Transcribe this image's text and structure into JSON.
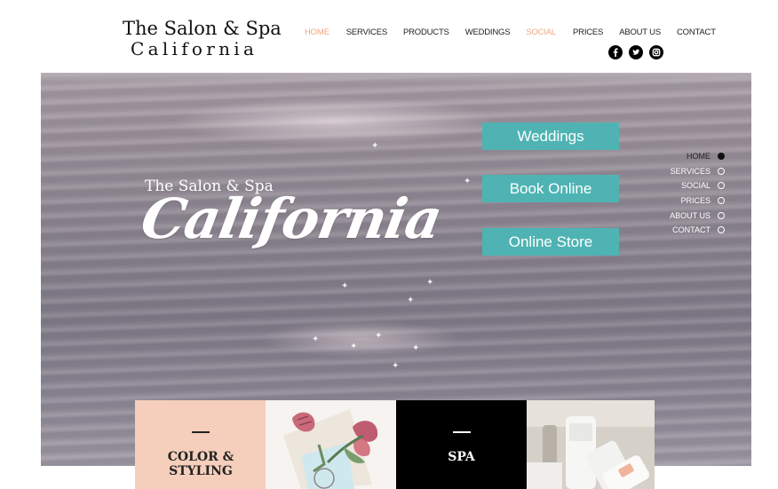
{
  "brand": {
    "line1": "The Salon & Spa",
    "line2": "California"
  },
  "nav": {
    "items": [
      {
        "label": "HOME"
      },
      {
        "label": "SERVICES"
      },
      {
        "label": "PRODUCTS"
      },
      {
        "label": "WEDDINGS"
      },
      {
        "label": "SOCIAL"
      },
      {
        "label": "PRICES"
      },
      {
        "label": "ABOUT US"
      },
      {
        "label": "CONTACT"
      }
    ],
    "accent_color": "#f0a882"
  },
  "social_icons": [
    "facebook-icon",
    "twitter-icon",
    "instagram-icon"
  ],
  "hero": {
    "subtitle": "The Salon & Spa",
    "script_title": "California",
    "buttons": [
      {
        "label": "Weddings"
      },
      {
        "label": "Book Online"
      },
      {
        "label": "Online Store"
      }
    ],
    "button_color": "#4fb3b3"
  },
  "side_nav": {
    "items": [
      {
        "label": "HOME",
        "active": true
      },
      {
        "label": "SERVICES",
        "active": false
      },
      {
        "label": "SOCIAL",
        "active": false
      },
      {
        "label": "PRICES",
        "active": false
      },
      {
        "label": "ABOUT US",
        "active": false
      },
      {
        "label": "CONTACT",
        "active": false
      }
    ]
  },
  "tiles": {
    "color_styling": "COLOR & STYLING",
    "spa": "SPA",
    "color_bg": "#f5cfbc",
    "spa_bg": "#000000"
  }
}
